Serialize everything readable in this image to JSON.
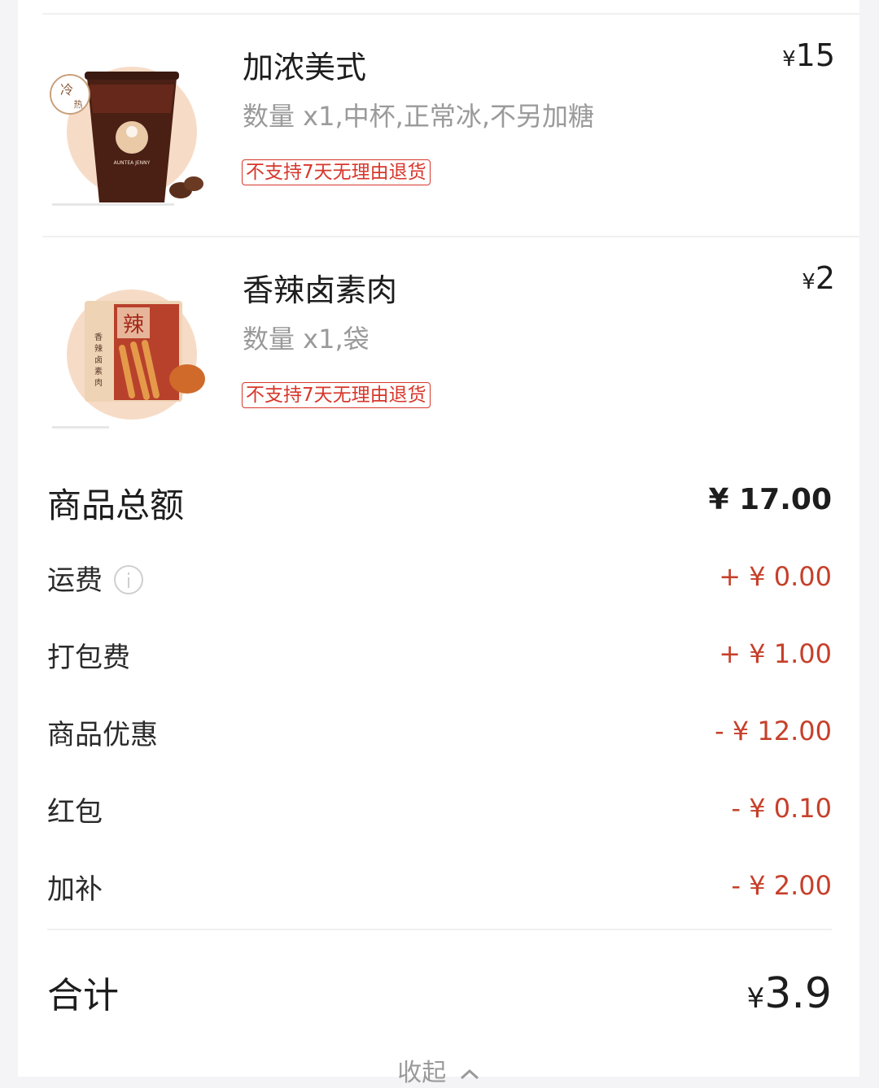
{
  "items": [
    {
      "name": "加浓美式",
      "spec": "数量 x1,中杯,正常冰,不另加糖",
      "tag": "不支持7天无理由退货",
      "price_symbol": "¥",
      "price": "15",
      "image": {
        "icon": "iced-coffee-cup-image",
        "badge": "冷 热",
        "cup_text": "AUNTEA JENNY 沪上阿姨"
      }
    },
    {
      "name": "香辣卤素肉",
      "spec": "数量 x1,袋",
      "tag": "不支持7天无理由退货",
      "price_symbol": "¥",
      "price": "2",
      "image": {
        "icon": "spicy-snack-bag-image",
        "pack_title": "香辣卤素肉",
        "pack_badge": "辣"
      }
    }
  ],
  "summary": {
    "subtotal_label": "商品总额",
    "subtotal_value": "¥ 17.00",
    "rows": [
      {
        "label": "运费",
        "value": "+ ¥ 0.00",
        "info_icon": "info-icon"
      },
      {
        "label": "打包费",
        "value": "+ ¥ 1.00"
      },
      {
        "label": "商品优惠",
        "value": "- ¥ 12.00"
      },
      {
        "label": "红包",
        "value": "- ¥ 0.10"
      },
      {
        "label": "加补",
        "value": "- ¥ 2.00"
      }
    ],
    "total_label": "合计",
    "total_symbol": "¥",
    "total_value": "3.9",
    "collapse_label": "收起",
    "collapse_icon": "chevron-up-icon"
  },
  "colors": {
    "accent_red": "#c6402a",
    "tag_red": "#d7372b",
    "muted": "#9a9a9a",
    "background": "#f4f4f6"
  }
}
